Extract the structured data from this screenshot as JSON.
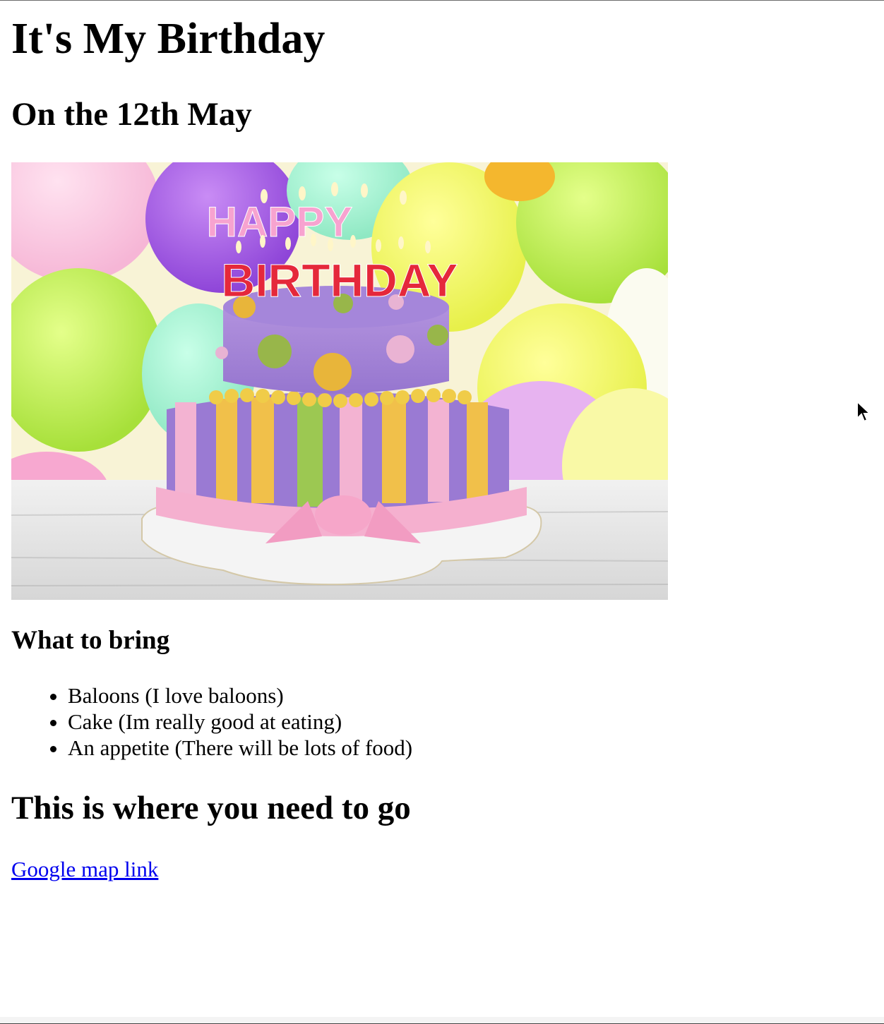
{
  "page": {
    "title": "It's My Birthday",
    "date_heading": "On the 12th May",
    "image": {
      "description_icon": "birthday-cake-image",
      "cake_text_line1": "HAPPY",
      "cake_text_line2": "BIRTHDAY"
    },
    "bring_heading": "What to bring",
    "bring_items": [
      "Baloons (I love baloons)",
      "Cake (Im really good at eating)",
      "An appetite (There will be lots of food)"
    ],
    "go_heading": "This is where you need to go",
    "map_link": "Google map link"
  },
  "colors": {
    "link": "#0000ee",
    "text": "#000000",
    "background": "#ffffff"
  },
  "icons": {
    "cursor": "mouse-pointer-icon"
  }
}
